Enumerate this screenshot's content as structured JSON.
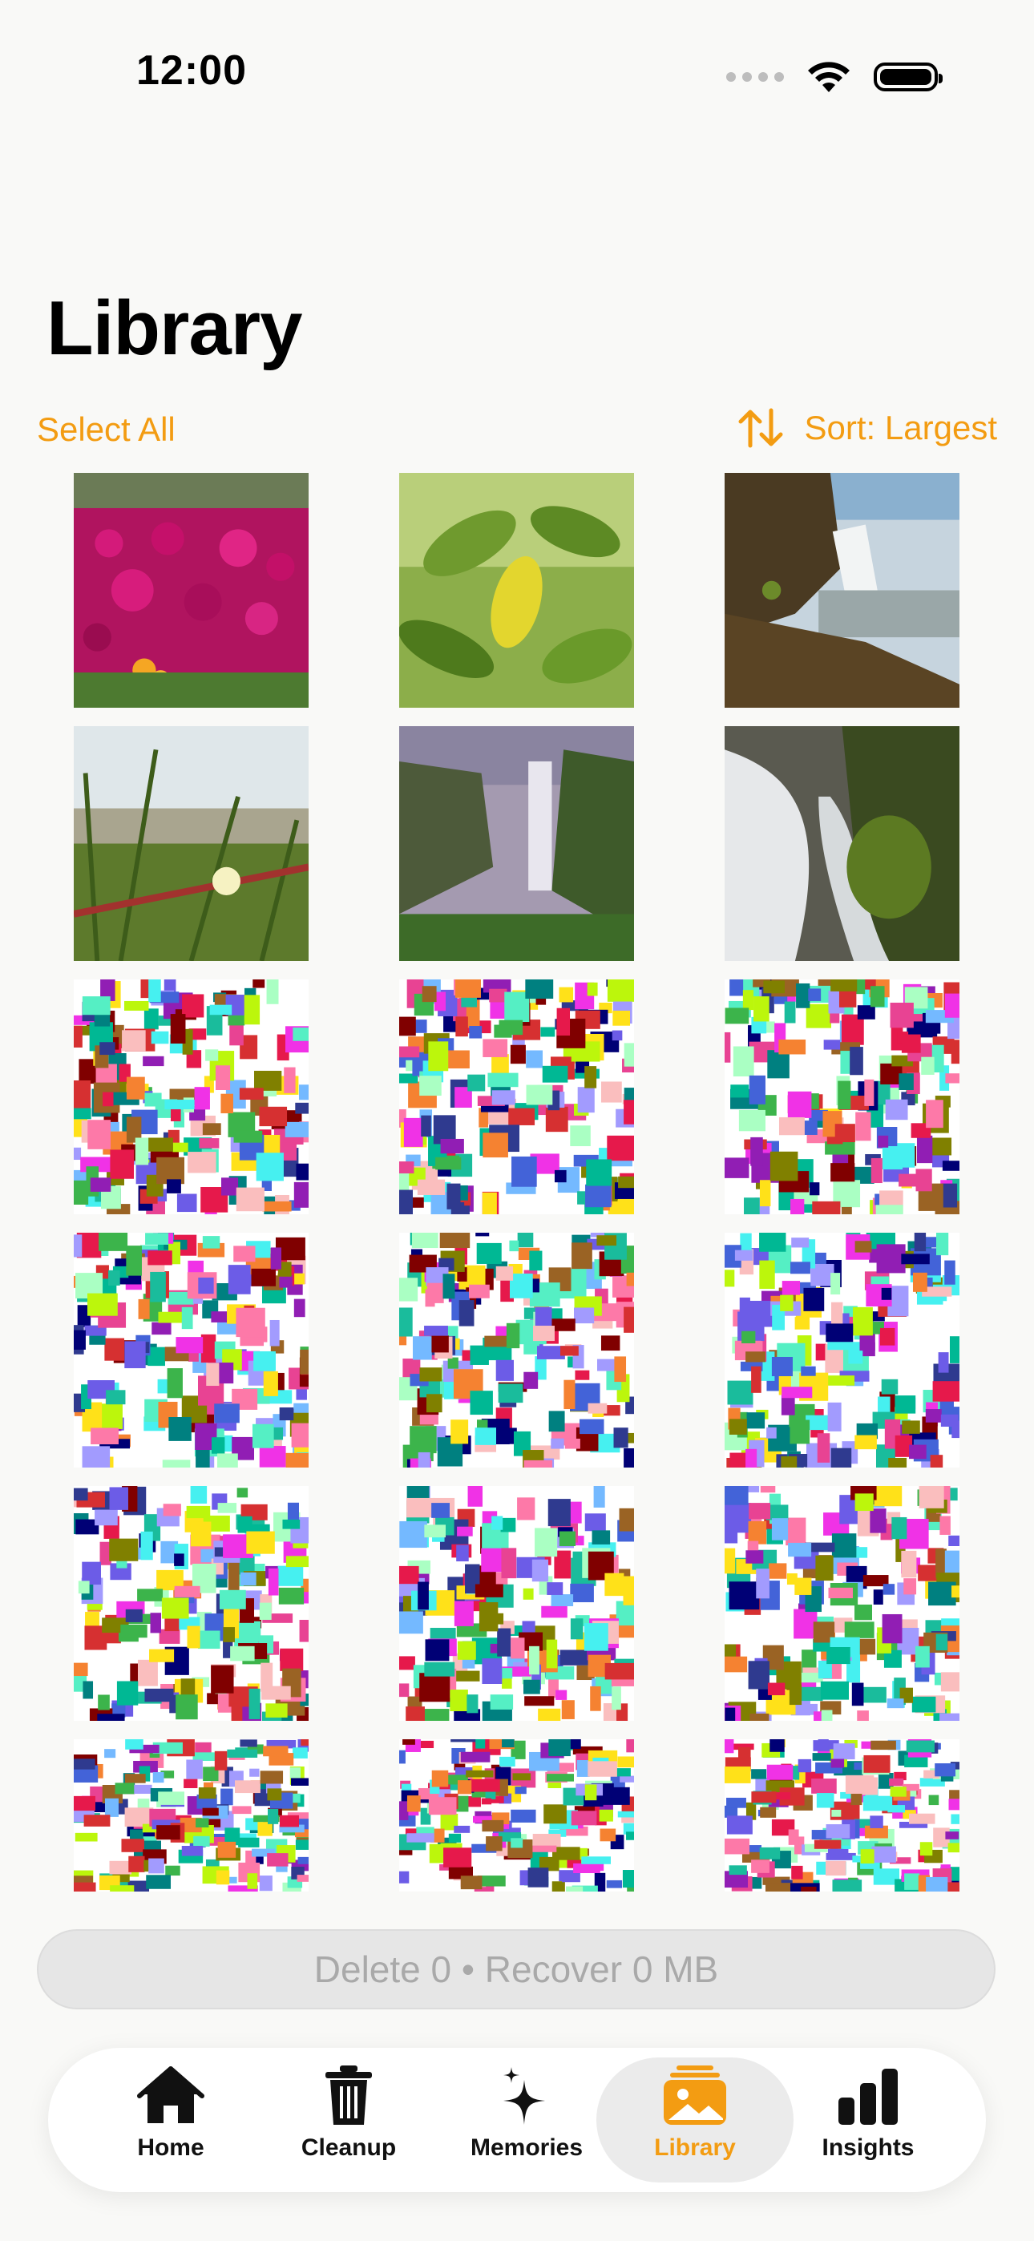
{
  "status_bar": {
    "time": "12:00"
  },
  "header": {
    "title": "Library"
  },
  "toolbar": {
    "select_all_label": "Select All",
    "sort_label": "Sort: Largest"
  },
  "photos": [
    {
      "kind": "photo",
      "subject": "pink flowers"
    },
    {
      "kind": "photo",
      "subject": "green leaves"
    },
    {
      "kind": "photo",
      "subject": "waterfall cliff"
    },
    {
      "kind": "photo",
      "subject": "beach grass with flower"
    },
    {
      "kind": "photo",
      "subject": "misty waterfall"
    },
    {
      "kind": "photo",
      "subject": "long exposure waterfall"
    },
    {
      "kind": "mosaic"
    },
    {
      "kind": "mosaic"
    },
    {
      "kind": "mosaic"
    },
    {
      "kind": "mosaic"
    },
    {
      "kind": "mosaic"
    },
    {
      "kind": "mosaic"
    },
    {
      "kind": "mosaic"
    },
    {
      "kind": "mosaic"
    },
    {
      "kind": "mosaic"
    },
    {
      "kind": "mosaic"
    },
    {
      "kind": "mosaic"
    },
    {
      "kind": "mosaic"
    }
  ],
  "delete_bar": {
    "label": "Delete 0 • Recover 0 MB"
  },
  "tabs": [
    {
      "label": "Home",
      "icon": "house-icon"
    },
    {
      "label": "Cleanup",
      "icon": "trash-icon"
    },
    {
      "label": "Memories",
      "icon": "sparkles-icon"
    },
    {
      "label": "Library",
      "icon": "photo-stack-icon",
      "active": true
    },
    {
      "label": "Insights",
      "icon": "bar-chart-icon"
    }
  ],
  "colors": {
    "accent": "#f39c12",
    "background": "#f9f9f7"
  }
}
